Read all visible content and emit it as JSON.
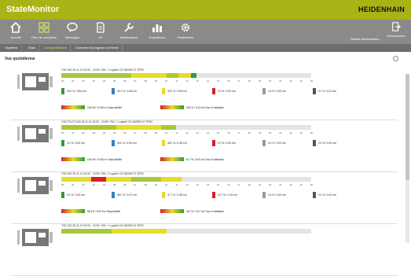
{
  "app": {
    "title": "StateMonitor",
    "brand": "HEIDENHAIN"
  },
  "nav": {
    "items": [
      {
        "label": "Accueil",
        "icon": "home-icon"
      },
      {
        "label": "Parc de machines",
        "icon": "machine-park-icon"
      },
      {
        "label": "Messages",
        "icon": "message-icon"
      },
      {
        "label": "UP",
        "icon": "document-icon"
      },
      {
        "label": "Maintenance",
        "icon": "wrench-icon"
      },
      {
        "label": "Evaluations",
        "icon": "bar-chart-icon"
      },
      {
        "label": "Paramètres",
        "icon": "gear-icon"
      }
    ],
    "user_label": "Default Administrator",
    "logout_label": "Déconnexion"
  },
  "tabs": [
    "Vignettes",
    "Etats",
    "Vue quotidienne",
    "Overview of program run times"
  ],
  "active_tab": "Vue quotidienne",
  "section_title": "Vue quotidienne",
  "hours": [
    "00",
    "01",
    "02",
    "03",
    "04",
    "05",
    "06",
    "07",
    "08",
    "09",
    "10",
    "11",
    "12",
    "13",
    "14",
    "15",
    "16",
    "17",
    "18",
    "19",
    "20",
    "21",
    "22",
    "23",
    "00"
  ],
  "colors": {
    "green": "#2e9b3e",
    "blue": "#3a7fc0",
    "yellow": "#e6dc2a",
    "red": "#d6202a",
    "gray": "#9a9a9a",
    "darkgray": "#555555",
    "lightgreen": "#a8c83a"
  },
  "machines": [
    {
      "title": "TNC 640   25.11.21 00:00 - 23:59  /  SIK  /  /  Logiciel CN   340590 07 SP3C",
      "legend": [
        "16.0 % / 3.84 h:m",
        "34.1 % / 3.28 h:m",
        "43.2 % / 4.54 h:m",
        "0.0 % / 0.00 h:m",
        "0.0 % / 0.00 h:m",
        "3.7 % / 0.21 h:m"
      ],
      "availability": "100,0% / 6:26 h:m Disponibilité",
      "utilisation": "35,2% / 3:13 h:m Taux d'utilisation"
    },
    {
      "title": "CNC PILOT 640   25.11.21 00:00 - 23:59  /  SIK  /  /  Logiciel CN   340590 07 SP3C",
      "legend": [
        "0.0 % / 0.00 h:m",
        "50.0 % / 4.59 h:m",
        "46.2 % / 4.45 h:m",
        "0.0 % / 0.00 h:m",
        "0.0 % / 0.00 h:m",
        "0.0 % / 0.00 h:m"
      ],
      "availability": "100,0% / 9:46 h:m Disponibilité",
      "utilisation": "51,7% / 5:04 h:m Taux d'utilisation"
    },
    {
      "title": "TNC 620   25.11.21 00:00 - 23:59  /  SIK  /  /  Logiciel CN   340590 07 SP3C",
      "legend": [
        "0.0 % / 0.00 h:m",
        "38.0 % / 3.47 h:m",
        "47.7 % / 4.45 h:m",
        "13.7 % / 1.20 h:m",
        "0.0 % / 0.00 h:m",
        "0.0 % / 0.00 h:m"
      ],
      "availability": "86,3% / 8:29 h:m Disponibilité",
      "utilisation": "38,7% / 3:47 h:m Taux d'utilisation"
    },
    {
      "title": "TNC 320   25.11.21 00:00 - 23:59  /  SIK  /  /  Logiciel CN   340590 07 SP3C",
      "legend": [],
      "availability": "",
      "utilisation": ""
    }
  ]
}
